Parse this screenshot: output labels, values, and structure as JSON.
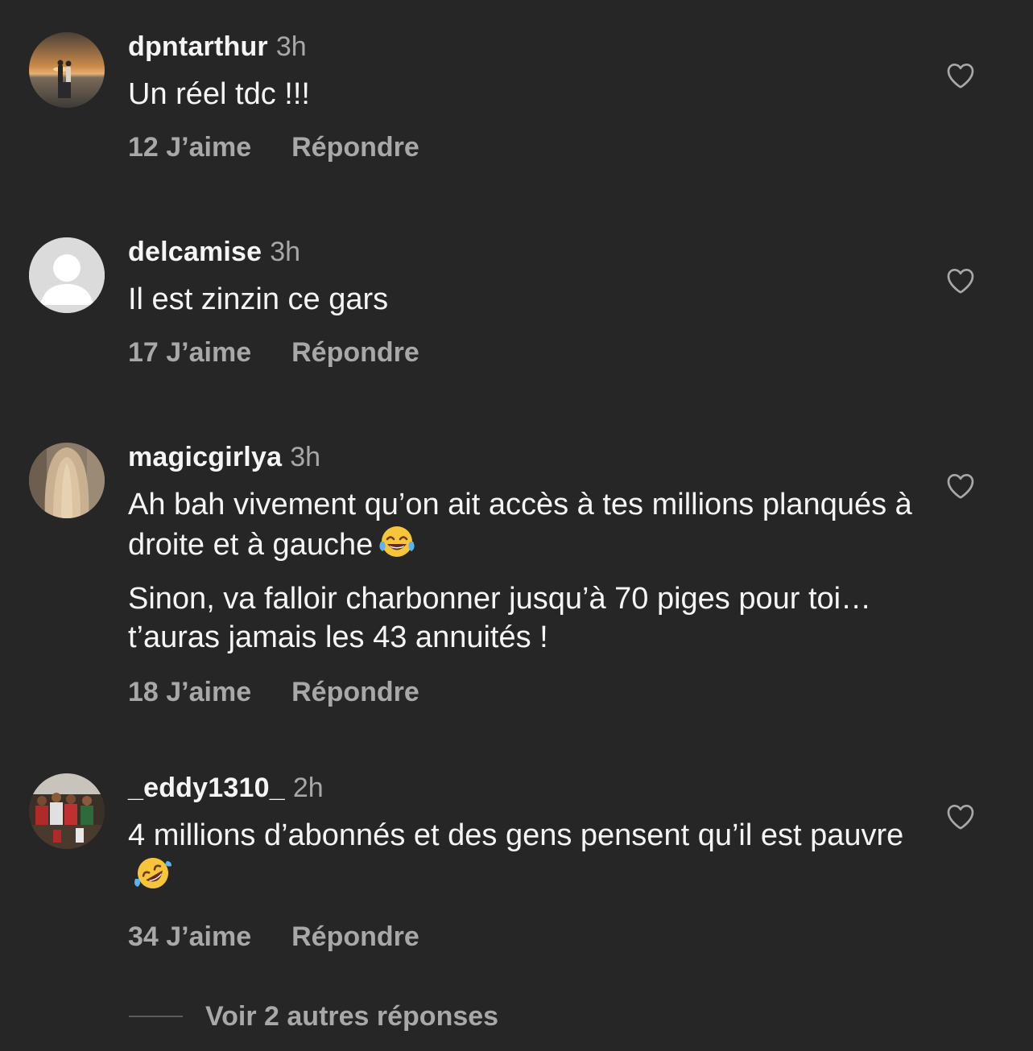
{
  "comments": [
    {
      "username": "dpntarthur",
      "time": "3h",
      "text": [
        "Un réel tdc !!!"
      ],
      "likes": "12 J’aime",
      "reply": "Répondre"
    },
    {
      "username": "delcamise",
      "time": "3h",
      "text": [
        "Il est zinzin ce gars"
      ],
      "likes": "17 J’aime",
      "reply": "Répondre"
    },
    {
      "username": "magicgirlya",
      "time": "3h",
      "text": [
        "Ah bah vivement qu’on ait accès à tes millions planqués à droite et à gauche",
        "Sinon, va falloir charbonner jusqu’à 70 piges pour toi… t’auras jamais les 43 annuités !"
      ],
      "emoji": "face-with-tears-of-joy",
      "likes": "18 J’aime",
      "reply": "Répondre"
    },
    {
      "username": "_eddy1310_",
      "time": "2h",
      "text": [
        "4 millions d’abonnés et des gens pensent qu’il est pauvre"
      ],
      "emoji": "rolling-on-the-floor-laughing",
      "likes": "34 J’aime",
      "reply": "Répondre"
    }
  ],
  "view_more": "Voir 2 autres réponses",
  "icons": {
    "like": "heart-outline-icon",
    "default_avatar": "person-silhouette-icon"
  },
  "colors": {
    "background": "#262626",
    "primary_text": "#f5f5f5",
    "secondary_text": "#a8a8a8"
  }
}
